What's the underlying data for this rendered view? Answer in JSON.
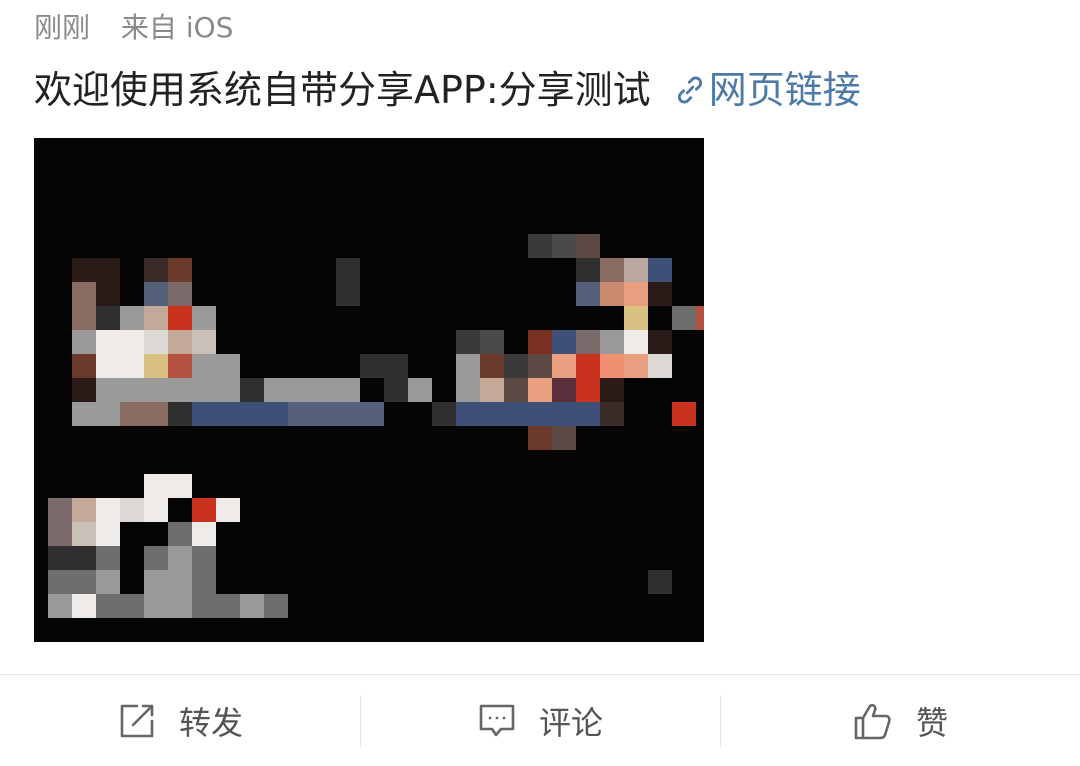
{
  "post": {
    "time": "刚刚",
    "source": "来自 iOS",
    "text": "欢迎使用系统自带分享APP:分享测试",
    "link_label": "网页链接"
  },
  "actions": {
    "repost": "转发",
    "comment": "评论",
    "like": "赞"
  },
  "colors": {
    "link": "#4d7aa6",
    "meta": "#8a8a8a",
    "text": "#222222"
  },
  "icons": [
    "link-icon",
    "repost-icon",
    "comment-icon",
    "like-icon"
  ]
}
